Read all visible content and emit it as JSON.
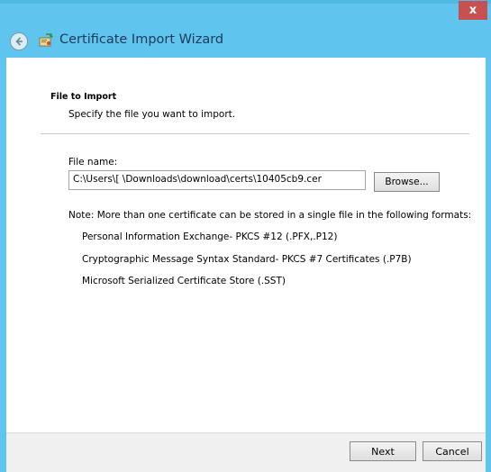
{
  "window": {
    "title": "Certificate Import Wizard",
    "close_glyph": "x",
    "back_icon": "back-arrow-icon",
    "wizard_icon": "certificate-icon"
  },
  "section": {
    "title": "File to Import",
    "subtitle": "Specify the file you want to import."
  },
  "file": {
    "label": "File name:",
    "value": "C:\\Users\\[           \\Downloads\\download\\certs\\10405cb9.cer",
    "browse_label": "Browse..."
  },
  "note": "Note:  More than one certificate can be stored in a single file in the following formats:",
  "formats": [
    "Personal Information Exchange- PKCS #12 (.PFX,.P12)",
    "Cryptographic Message Syntax Standard- PKCS #7 Certificates (.P7B)",
    "Microsoft Serialized Certificate Store (.SST)"
  ],
  "footer": {
    "next_label": "Next",
    "cancel_label": "Cancel"
  },
  "colors": {
    "titlebar": "#5fc5ee",
    "close": "#c75050"
  }
}
